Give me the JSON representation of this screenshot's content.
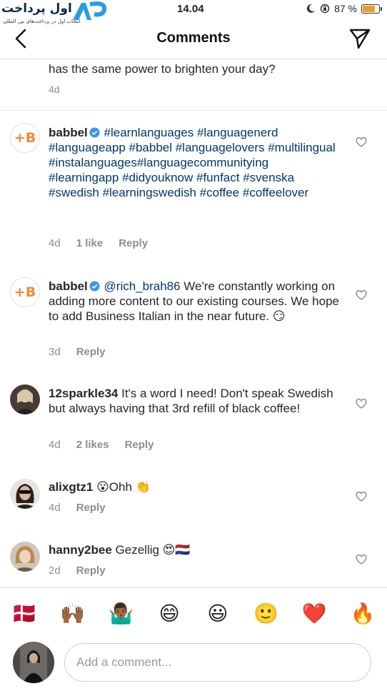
{
  "status_bar": {
    "time": "14.04",
    "battery_percent": "87 %",
    "battery_level": 0.87
  },
  "watermark": {
    "text": "اول پرداخت",
    "subtext": "انتخاب اول در پرداخت‌های بین المللی"
  },
  "header": {
    "title": "Comments"
  },
  "cut_comment": {
    "text": "has the same power to brighten your day?",
    "time": "4d"
  },
  "comments": [
    {
      "username": "babbel",
      "verified": true,
      "text": "#learnlanguages #languagenerd #languageapp #babbel #languagelovers #multilingual #instalanguages#languagecommunitying #learningapp #didyouknow #funfact #svenska #swedish #learningswedish #coffee #coffeelover",
      "time": "4d",
      "likes": "1 like",
      "reply": "Reply"
    },
    {
      "username": "babbel",
      "verified": true,
      "mention": "@rich_brah86",
      "text": " We're constantly working on adding more content to our existing courses. We hope to add Business Italian in the near future. 😏",
      "time": "3d",
      "reply": "Reply"
    },
    {
      "username": "12sparkle34",
      "text": " It's a word I need! Don't speak Swedish but always having that 3rd refill of black coffee!",
      "time": "4d",
      "likes": "2 likes",
      "reply": "Reply"
    },
    {
      "username": "alixgtz1",
      "text": " 😮Ohh 👏",
      "time": "4d",
      "reply": "Reply"
    },
    {
      "username": "hanny2bee",
      "text": " Gezellig 😍🇳🇱",
      "time": "2d",
      "reply": "Reply"
    }
  ],
  "quick_emojis": [
    "🇩🇰",
    "🙌🏾",
    "🤷🏾‍♂️",
    "😄",
    "😃",
    "🙂",
    "❤️",
    "🔥"
  ],
  "comment_input": {
    "placeholder": "Add a comment..."
  },
  "colors": {
    "hashtag": "#00376b",
    "meta": "#8e8e8e",
    "brand_orange": "#f08a3a",
    "verified_blue": "#3897f0"
  }
}
